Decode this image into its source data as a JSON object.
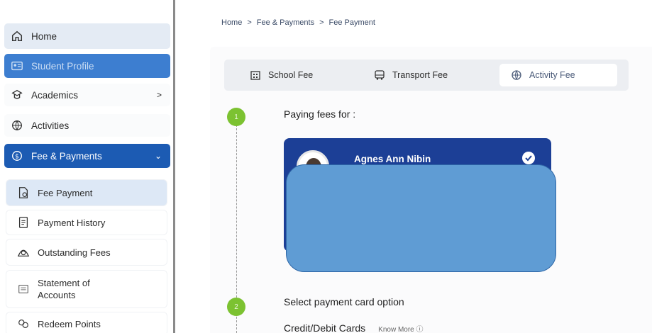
{
  "sidebar": {
    "items": [
      {
        "label": "Home",
        "icon": "home-icon"
      },
      {
        "label": "Student Profile",
        "icon": "profile-card-icon"
      },
      {
        "label": "Academics",
        "icon": "academics-icon",
        "arrow": ">"
      },
      {
        "label": "Activities",
        "icon": "activities-icon"
      },
      {
        "label": "Fee & Payments",
        "icon": "fee-icon",
        "arrow": "⌄"
      }
    ],
    "sub_items": [
      {
        "label": "Fee Payment",
        "icon": "fee-payment-icon"
      },
      {
        "label": "Payment History",
        "icon": "payment-history-icon"
      },
      {
        "label": "Outstanding Fees",
        "icon": "outstanding-fees-icon"
      },
      {
        "label": "Statement of Accounts",
        "icon": "statement-icon"
      },
      {
        "label": "Redeem Points",
        "icon": "redeem-points-icon"
      }
    ]
  },
  "breadcrumb": {
    "home": "Home",
    "section": "Fee & Payments",
    "current": "Fee Payment",
    "separator": ">"
  },
  "tabs": [
    {
      "label": "School Fee",
      "icon": "school-fee-icon"
    },
    {
      "label": "Transport Fee",
      "icon": "bus-icon"
    },
    {
      "label": "Activity Fee",
      "icon": "activity-ball-icon",
      "selected": true
    }
  ],
  "steps": [
    {
      "number": "1",
      "title": "Paying fees for :"
    },
    {
      "number": "2",
      "title": "Select payment card option"
    }
  ],
  "student": {
    "name": "Agnes Ann Nibin"
  },
  "payment": {
    "option": "Credit/Debit Cards",
    "know_more": "Know More ⓘ"
  },
  "colors": {
    "primary": "#1c5bb3",
    "profile_active": "#3d7ed0",
    "step_green": "#7cc231",
    "card_blue": "#1c3f96",
    "redaction": "#5f9cd4"
  }
}
